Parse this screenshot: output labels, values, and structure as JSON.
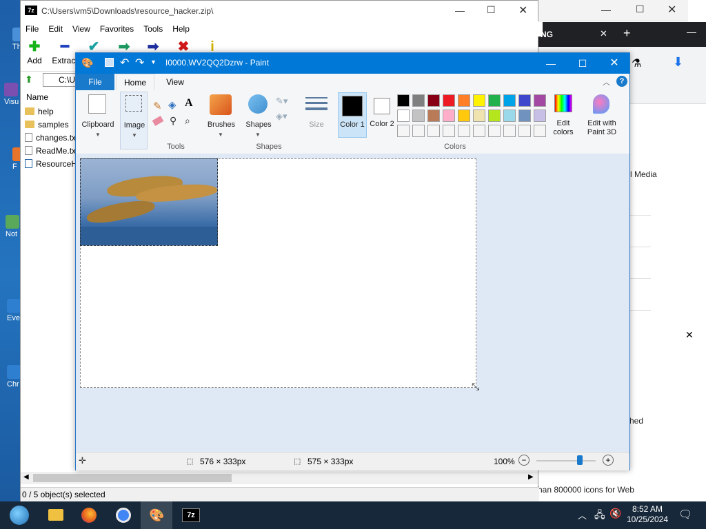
{
  "desktop": {
    "icons": [
      {
        "label": "Th",
        "color": "#4a90d9"
      },
      {
        "label": "Visu",
        "color": "#7a4fb0"
      },
      {
        "label": "F",
        "color": "#e8742a"
      },
      {
        "label": "Not",
        "color": "#5aa85a"
      },
      {
        "label": "Eve",
        "color": "#2f7fd0"
      },
      {
        "label": "Chr",
        "color": "#2f7fd0"
      }
    ]
  },
  "browser": {
    "tab_text": "NG",
    "side_texts": [
      "l Media",
      "hed",
      "han 800000 icons for Web"
    ]
  },
  "zip": {
    "title": "C:\\Users\\vm5\\Downloads\\resource_hacker.zip\\",
    "menu": [
      "File",
      "Edit",
      "View",
      "Favorites",
      "Tools",
      "Help"
    ],
    "toolbar": [
      {
        "label": "Add",
        "glyph": "✚",
        "color": "#18b318"
      },
      {
        "label": "Extract",
        "glyph": "━",
        "color": "#1f3fbf"
      },
      {
        "label": "",
        "glyph": "✔",
        "color": "#1aa2a2"
      },
      {
        "label": "",
        "glyph": "➡",
        "color": "#1a9a60"
      },
      {
        "label": "",
        "glyph": "➡",
        "color": "#1f2f9f"
      },
      {
        "label": "",
        "glyph": "✖",
        "color": "#d01818"
      },
      {
        "label": "",
        "glyph": "i",
        "color": "#d0b000"
      }
    ],
    "address": "C:\\U",
    "column_name": "Name",
    "files": [
      {
        "name": "help",
        "type": "folder"
      },
      {
        "name": "samples",
        "type": "folder"
      },
      {
        "name": "changes.txt",
        "type": "file"
      },
      {
        "name": "ReadMe.txt",
        "type": "file"
      },
      {
        "name": "ResourceH",
        "type": "exe"
      }
    ],
    "status": "0 / 5 object(s) selected"
  },
  "paint": {
    "title": "I0000.WV2QQ2Dzrw - Paint",
    "tabs": {
      "file": "File",
      "home": "Home",
      "view": "View"
    },
    "groups": {
      "clipboard": "Clipboard",
      "image": "Image",
      "tools": "Tools",
      "brushes": "Brushes",
      "shapes_btn": "Shapes",
      "shapes": "Shapes",
      "size": "Size",
      "color1": "Color 1",
      "color2": "Color 2",
      "colors": "Colors",
      "edit_colors": "Edit colors",
      "edit_paint3d": "Edit with Paint 3D"
    },
    "palette_row1": [
      "#000000",
      "#7f7f7f",
      "#880015",
      "#ed1c24",
      "#ff7f27",
      "#fff200",
      "#22b14c",
      "#00a2e8",
      "#3f48cc",
      "#a349a4"
    ],
    "palette_row2": [
      "#ffffff",
      "#c3c3c3",
      "#b97a57",
      "#ffaec9",
      "#ffc90e",
      "#efe4b0",
      "#b5e61d",
      "#99d9ea",
      "#7092be",
      "#c8bfe7"
    ],
    "palette_row3": [
      "#f5f5f5",
      "#f5f5f5",
      "#f5f5f5",
      "#f5f5f5",
      "#f5f5f5",
      "#f5f5f5",
      "#f5f5f5",
      "#f5f5f5",
      "#f5f5f5",
      "#f5f5f5"
    ],
    "color1_value": "#000000",
    "color2_value": "#ffffff",
    "status": {
      "selection_size": "576 × 333px",
      "image_size": "575 × 333px",
      "zoom": "100%"
    }
  },
  "taskbar": {
    "time": "8:52 AM",
    "date": "10/25/2024"
  }
}
